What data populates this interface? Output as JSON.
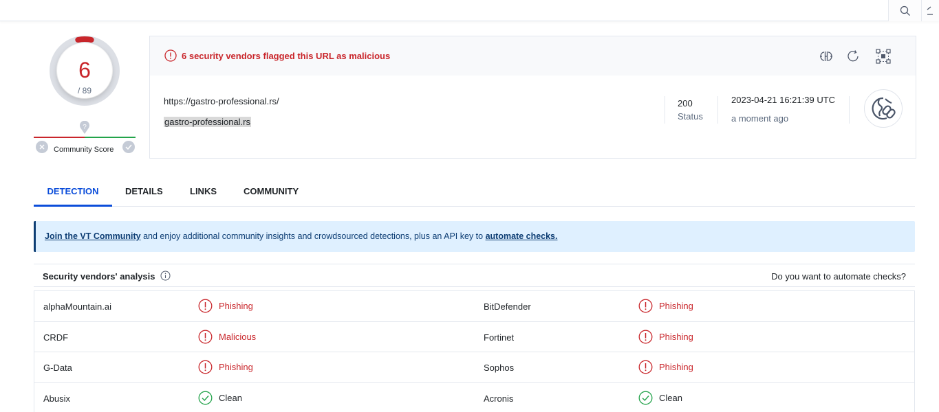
{
  "header": {
    "search_icon": "search-icon",
    "more_icon": "chevron-icon"
  },
  "score": {
    "detections": "6",
    "total": "/ 89",
    "fraction": 0.0674,
    "colors": {
      "malicious": "#c9262b",
      "harmless": "#22a34a"
    }
  },
  "community": {
    "label": "Community Score",
    "unknown_icon": "question-marker-icon"
  },
  "summary": {
    "alert": "6 security vendors flagged this URL as malicious",
    "url": "https://gastro-professional.rs/",
    "domain": "gastro-professional.rs",
    "status_code": "200",
    "status_label": "Status",
    "date": "2023-04-21 16:21:39 UTC",
    "relative_time": "a moment ago",
    "actions": [
      "compare-icon",
      "reanalyze-icon",
      "graph-icon"
    ]
  },
  "tabs": [
    {
      "label": "DETECTION",
      "active": true
    },
    {
      "label": "DETAILS",
      "active": false
    },
    {
      "label": "LINKS",
      "active": false
    },
    {
      "label": "COMMUNITY",
      "active": false
    }
  ],
  "banner": {
    "link1": "Join the VT Community",
    "middle": " and enjoy additional community insights and crowdsourced detections, plus an API key to ",
    "link2": "automate checks."
  },
  "vendors": {
    "title": "Security vendors' analysis",
    "automate": "Do you want to automate checks?",
    "rows": [
      {
        "left": {
          "name": "alphaMountain.ai",
          "result": "Phishing",
          "status": "bad"
        },
        "right": {
          "name": "BitDefender",
          "result": "Phishing",
          "status": "bad"
        }
      },
      {
        "left": {
          "name": "CRDF",
          "result": "Malicious",
          "status": "bad"
        },
        "right": {
          "name": "Fortinet",
          "result": "Phishing",
          "status": "bad"
        }
      },
      {
        "left": {
          "name": "G-Data",
          "result": "Phishing",
          "status": "bad"
        },
        "right": {
          "name": "Sophos",
          "result": "Phishing",
          "status": "bad"
        }
      },
      {
        "left": {
          "name": "Abusix",
          "result": "Clean",
          "status": "ok"
        },
        "right": {
          "name": "Acronis",
          "result": "Clean",
          "status": "ok"
        }
      }
    ]
  }
}
